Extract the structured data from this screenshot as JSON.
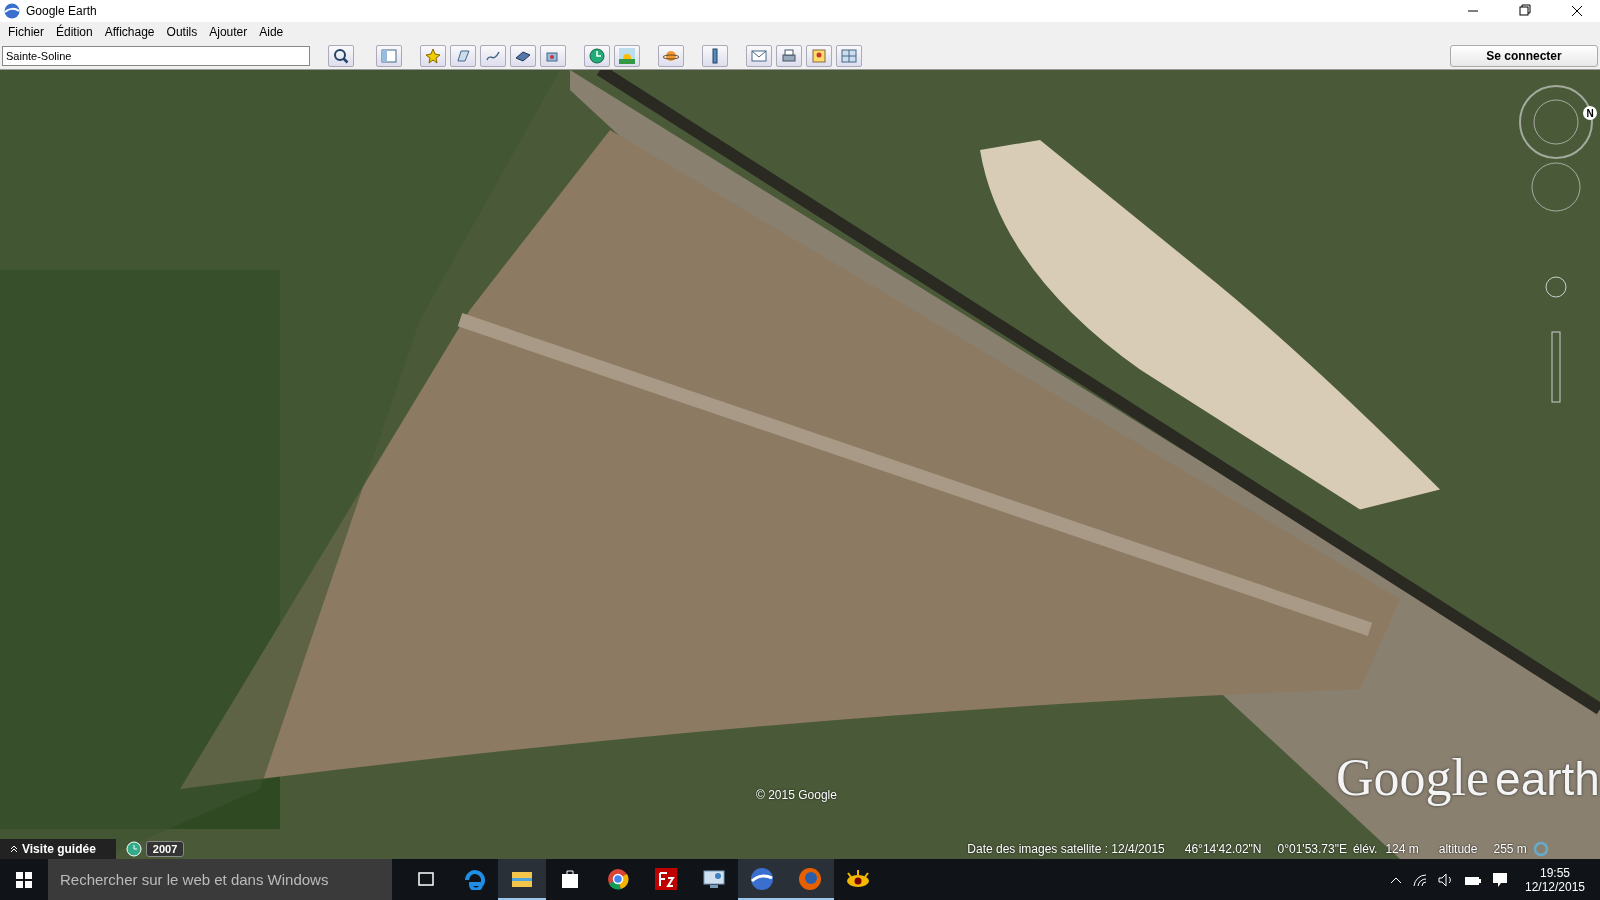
{
  "window": {
    "title": "Google Earth"
  },
  "menu": [
    "Fichier",
    "Édition",
    "Affichage",
    "Outils",
    "Ajouter",
    "Aide"
  ],
  "search": {
    "value": "Sainte-Soline"
  },
  "sign_in": "Se connecter",
  "map": {
    "copyright": "© 2015 Google",
    "logo": [
      "Google",
      "earth"
    ],
    "compass_letter": "N"
  },
  "tour": {
    "label": "Visite guidée"
  },
  "history": {
    "year": "2007"
  },
  "status": {
    "imagery_date": "Date des images satellite : 12/4/2015",
    "latitude": "46°14'42.02\"N",
    "longitude": "0°01'53.73\"E",
    "elevation_label": "élév.",
    "elevation": "124 m",
    "altitude_label": "altitude",
    "altitude": "255 m"
  },
  "taskbar": {
    "search_placeholder": "Rechercher sur le web et dans Windows",
    "apps": [
      {
        "kind": "edge",
        "selected": false
      },
      {
        "kind": "folder",
        "selected": true
      },
      {
        "kind": "store",
        "selected": false
      },
      {
        "kind": "chrome",
        "selected": false
      },
      {
        "kind": "filezilla",
        "selected": false
      },
      {
        "kind": "remote",
        "selected": false
      },
      {
        "kind": "earth",
        "selected": true
      },
      {
        "kind": "firefox",
        "selected": true
      },
      {
        "kind": "eye",
        "selected": false
      }
    ],
    "time": "19:55",
    "date": "12/12/2015"
  }
}
